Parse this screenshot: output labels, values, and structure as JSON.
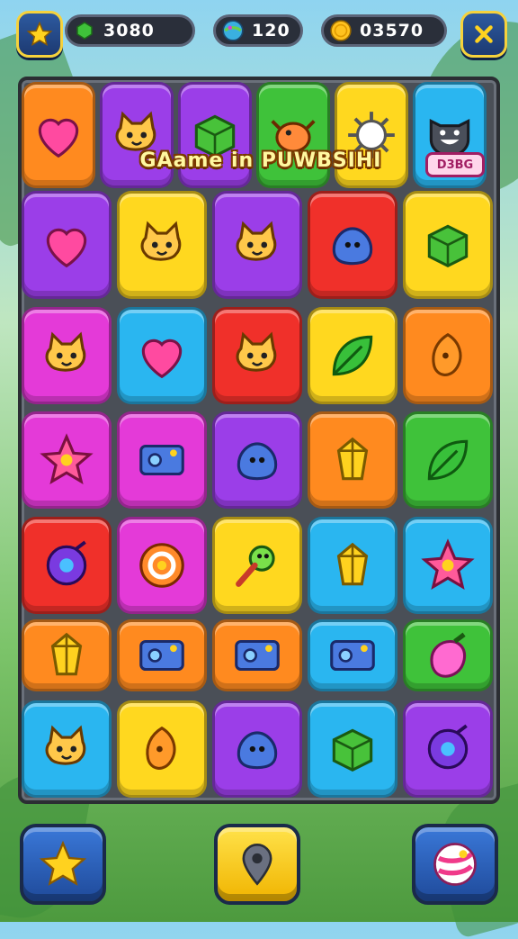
{
  "hud": {
    "gems": "3080",
    "orbs": "120",
    "coins": "03570",
    "left_button_icon": "star-icon",
    "right_button_icon": "close-icon"
  },
  "banner": {
    "text": "GAame in PUWBSIHI",
    "badge": "D3BG"
  },
  "colors": {
    "orange": "#ff8a1f",
    "purple": "#9b3ee8",
    "magenta": "#e43ad8",
    "green": "#3fc23a",
    "yellow": "#ffd81f",
    "blue": "#2ab6f0",
    "red": "#f0302a"
  },
  "grid": {
    "rows": [
      [
        {
          "color": "orange",
          "icon": "heart-icon"
        },
        {
          "color": "purple",
          "icon": "cat-icon"
        },
        {
          "color": "purple",
          "icon": "box-icon"
        },
        {
          "color": "green",
          "icon": "creature-icon"
        },
        {
          "color": "yellow",
          "icon": "spark-icon"
        },
        {
          "color": "blue",
          "icon": "wolf-icon"
        }
      ],
      [
        {
          "color": "purple",
          "icon": "heart-icon"
        },
        {
          "color": "yellow",
          "icon": "cat-icon"
        },
        {
          "color": "purple",
          "icon": "cat-icon"
        },
        {
          "color": "red",
          "icon": "blob-icon"
        },
        {
          "color": "yellow",
          "icon": "box-icon"
        }
      ],
      [
        {
          "color": "magenta",
          "icon": "cat-icon"
        },
        {
          "color": "blue",
          "icon": "heart-icon"
        },
        {
          "color": "red",
          "icon": "cat-icon"
        },
        {
          "color": "yellow",
          "icon": "leaf-icon"
        },
        {
          "color": "orange",
          "icon": "seed-icon"
        }
      ],
      [
        {
          "color": "magenta",
          "icon": "star-icon"
        },
        {
          "color": "magenta",
          "icon": "device-icon"
        },
        {
          "color": "purple",
          "icon": "blob-icon"
        },
        {
          "color": "orange",
          "icon": "crystal-icon"
        },
        {
          "color": "green",
          "icon": "leaf-icon"
        }
      ],
      [
        {
          "color": "red",
          "icon": "orb-icon"
        },
        {
          "color": "magenta",
          "icon": "ring-icon"
        },
        {
          "color": "yellow",
          "icon": "wand-icon"
        },
        {
          "color": "blue",
          "icon": "crystal-icon"
        },
        {
          "color": "blue",
          "icon": "star-icon"
        }
      ],
      [
        {
          "color": "orange",
          "icon": "crystal-icon"
        },
        {
          "color": "orange",
          "icon": "device-icon"
        },
        {
          "color": "orange",
          "icon": "device-icon"
        },
        {
          "color": "blue",
          "icon": "device-icon"
        },
        {
          "color": "green",
          "icon": "berry-icon"
        }
      ],
      [
        {
          "color": "blue",
          "icon": "cat-icon"
        },
        {
          "color": "yellow",
          "icon": "seed-icon"
        },
        {
          "color": "purple",
          "icon": "blob-icon"
        },
        {
          "color": "blue",
          "icon": "box-icon"
        },
        {
          "color": "purple",
          "icon": "orb-icon"
        }
      ]
    ]
  },
  "bottom": {
    "left_icon": "star-icon",
    "center_icon": "location-icon",
    "right_icon": "candy-icon"
  }
}
